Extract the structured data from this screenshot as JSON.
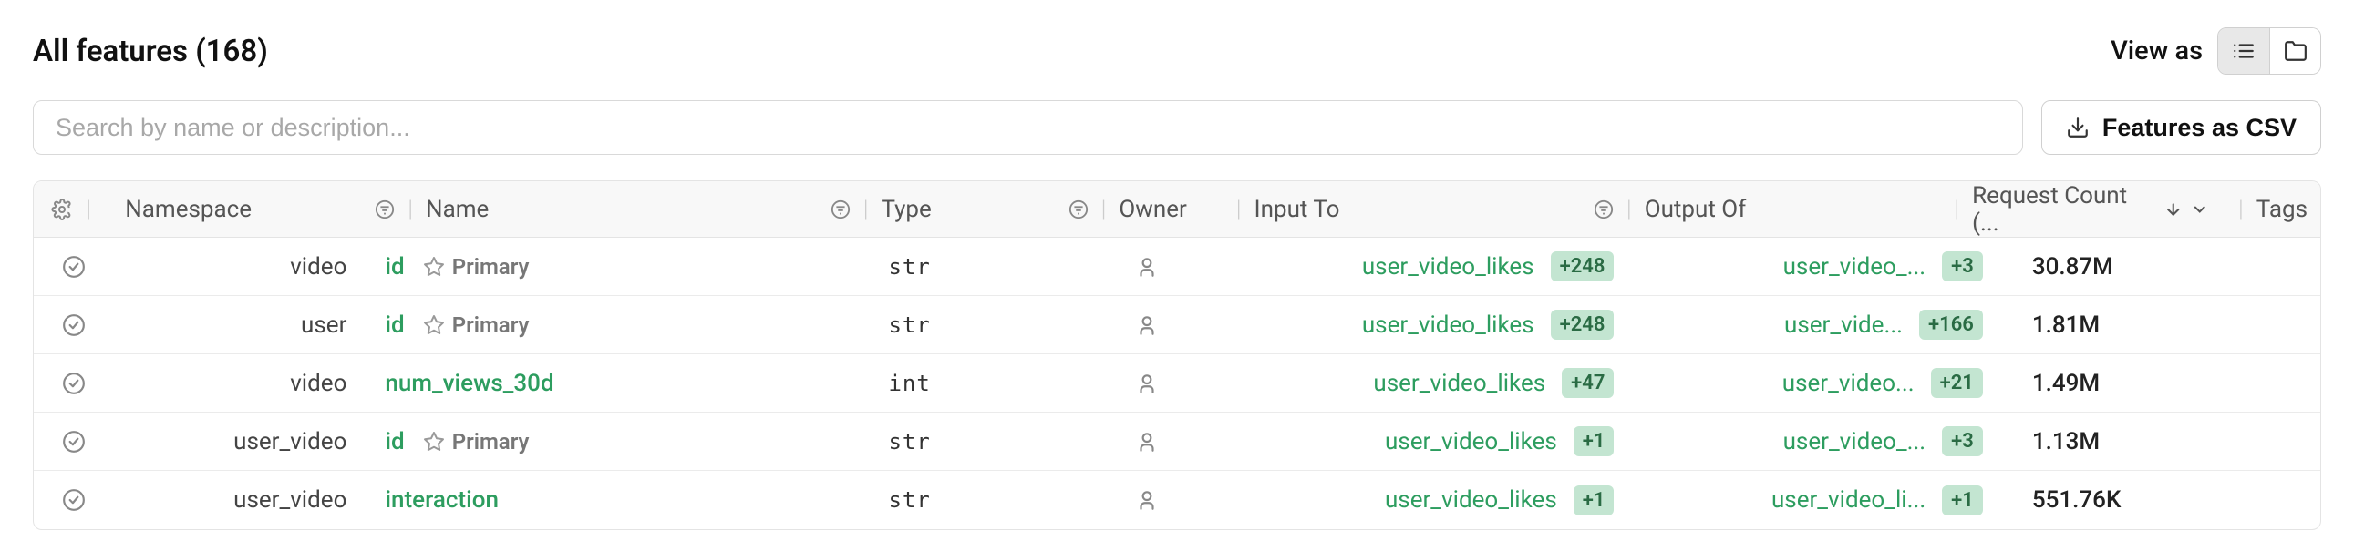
{
  "header": {
    "title": "All features (168)",
    "view_as": "View as",
    "csv_button": "Features as CSV"
  },
  "search": {
    "placeholder": "Search by name or description..."
  },
  "columns": {
    "namespace": "Namespace",
    "name": "Name",
    "type": "Type",
    "owner": "Owner",
    "input_to": "Input To",
    "output_of": "Output Of",
    "request_count": "Request Count (...",
    "tags": "Tags"
  },
  "rows": [
    {
      "namespace": "video",
      "name": "id",
      "primary": "Primary",
      "type": "str",
      "input_to": "user_video_likes",
      "input_to_count": "+248",
      "output_of": "user_video_...",
      "output_of_count": "+3",
      "request_count": "30.87M"
    },
    {
      "namespace": "user",
      "name": "id",
      "primary": "Primary",
      "type": "str",
      "input_to": "user_video_likes",
      "input_to_count": "+248",
      "output_of": "user_vide...",
      "output_of_count": "+166",
      "request_count": "1.81M"
    },
    {
      "namespace": "video",
      "name": "num_views_30d",
      "primary": "",
      "type": "int",
      "input_to": "user_video_likes",
      "input_to_count": "+47",
      "output_of": "user_video...",
      "output_of_count": "+21",
      "request_count": "1.49M"
    },
    {
      "namespace": "user_video",
      "name": "id",
      "primary": "Primary",
      "type": "str",
      "input_to": "user_video_likes",
      "input_to_count": "+1",
      "output_of": "user_video_...",
      "output_of_count": "+3",
      "request_count": "1.13M"
    },
    {
      "namespace": "user_video",
      "name": "interaction",
      "primary": "",
      "type": "str",
      "input_to": "user_video_likes",
      "input_to_count": "+1",
      "output_of": "user_video_li...",
      "output_of_count": "+1",
      "request_count": "551.76K"
    }
  ]
}
